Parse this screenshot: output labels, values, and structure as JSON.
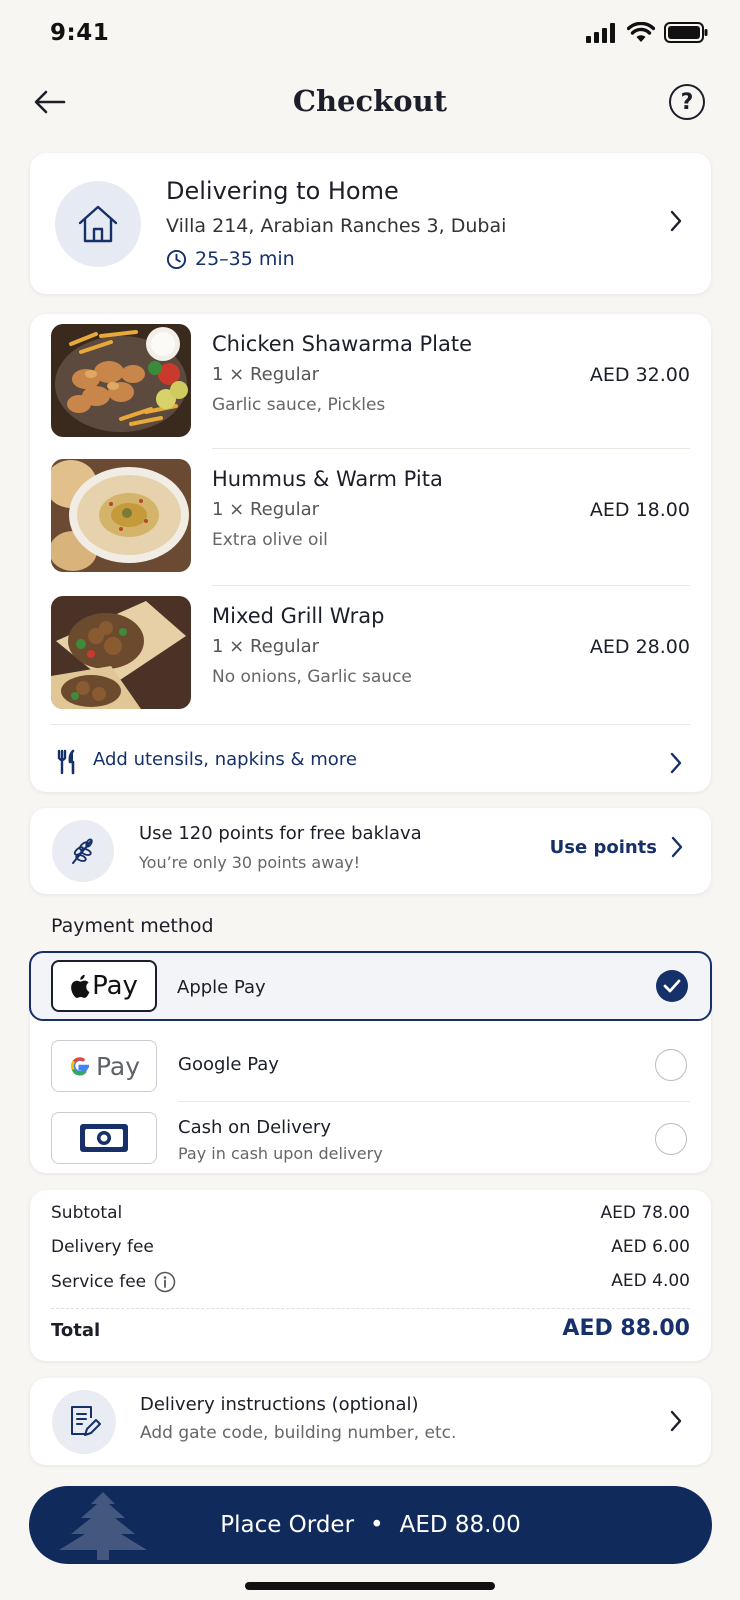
{
  "status_bar": {
    "time": "9:41"
  },
  "header": {
    "title": "Checkout",
    "help_label": "?"
  },
  "delivery": {
    "title": "Delivering to Home",
    "address": "Villa 214, Arabian Ranches 3, Dubai",
    "eta": "25–35 min"
  },
  "items": [
    {
      "name": "Chicken Shawarma Plate",
      "qty": "1 × Regular",
      "note": "Garlic sauce, Pickles",
      "price": "AED 32.00"
    },
    {
      "name": "Hummus & Warm Pita",
      "qty": "1 × Regular",
      "note": "Extra olive oil",
      "price": "AED 18.00"
    },
    {
      "name": "Mixed Grill Wrap",
      "qty": "1 × Regular",
      "note": "No onions, Garlic sauce",
      "price": "AED 28.00"
    }
  ],
  "utensils": {
    "label": "Add utensils, napkins & more"
  },
  "points": {
    "title": "Use 120 points for free baklava",
    "subtitle": "You’re only 30 points away!",
    "button": "Use points"
  },
  "payment": {
    "section_title": "Payment method",
    "options": [
      {
        "label": "Apple Pay",
        "logo_text": "Pay",
        "selected": true
      },
      {
        "label": "Google Pay",
        "logo_text": "Pay",
        "selected": false
      },
      {
        "label": "Cash on Delivery",
        "subtitle": "Pay in cash upon delivery",
        "selected": false
      }
    ]
  },
  "summary": {
    "subtotal_label": "Subtotal",
    "subtotal": "AED 78.00",
    "delivery_label": "Delivery fee",
    "delivery": "AED 6.00",
    "service_label": "Service fee",
    "service": "AED 4.00",
    "total_label": "Total",
    "total": "AED 88.00"
  },
  "instructions": {
    "title": "Delivery instructions (optional)",
    "subtitle": "Add gate code, building number, etc."
  },
  "place_order": {
    "label": "Place Order",
    "separator": "•",
    "amount": "AED 88.00"
  },
  "colors": {
    "accent": "#16306a",
    "button": "#102a5c",
    "background": "#f8f6f3"
  }
}
